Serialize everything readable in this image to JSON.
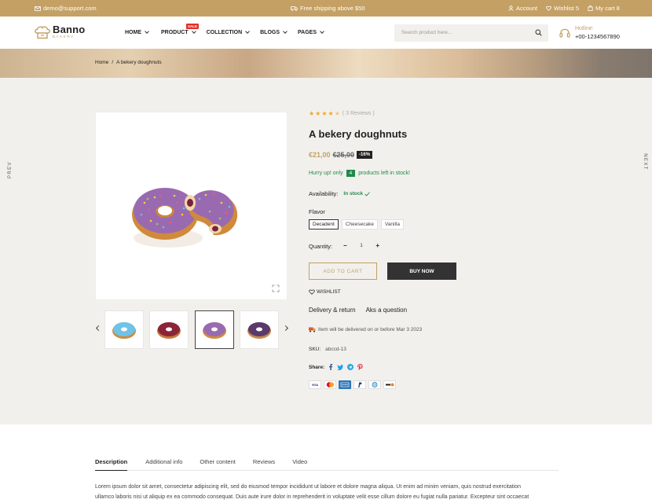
{
  "topbar": {
    "email": "demo@support.com",
    "shipping": "Free shipping above $50",
    "account": "Account",
    "wishlist": "Wishlist 5",
    "cart": "My cart 8"
  },
  "header": {
    "logo_name": "Banno",
    "logo_sub": "BAKERY",
    "nav": [
      {
        "label": "HOME"
      },
      {
        "label": "PRODUCT",
        "badge": "SALE"
      },
      {
        "label": "COLLECTION"
      },
      {
        "label": "BLOGS"
      },
      {
        "label": "PAGES"
      }
    ],
    "search_placeholder": "Search product here...",
    "hotline_label": "Hotline:",
    "hotline_number": "+00-1234567890"
  },
  "breadcrumb": {
    "home": "Home",
    "sep": "/",
    "current": "A bekery doughnuts"
  },
  "side": {
    "prev": "PREV",
    "next": "NEXT"
  },
  "product": {
    "rating": 4.5,
    "reviews": "( 3 Reviews )",
    "title": "A bekery doughnuts",
    "price": "€21,00",
    "old_price": "€25,00",
    "discount": "-16%",
    "stock_prefix": "Hurry up! only",
    "stock_count": "4",
    "stock_suffix": "products left in stock!",
    "availability_label": "Availability:",
    "availability_value": "In stock",
    "flavor_label": "Flavor",
    "flavors": [
      "Decadent",
      "Cheesecake",
      "Vanilla"
    ],
    "selected_flavor": 0,
    "quantity_label": "Quantity:",
    "quantity": "1",
    "add_to_cart": "ADD TO CART",
    "buy_now": "BUY NOW",
    "wishlist": "WISHLIST",
    "delivery_return": "Delivery & return",
    "ask_question": "Aks a question",
    "delivery_note": "Item will be delivered on or before Mar 3 2023",
    "sku_label": "SKU:",
    "sku_value": "abccd-13",
    "share_label": "Share:",
    "payments": [
      "VISA",
      "Mastercard",
      "American Express",
      "PayPal",
      "Diners",
      "Discover"
    ],
    "thumbnails": [
      "blue-doughnut",
      "red-doughnut",
      "purple-doughnut",
      "dark-doughnut"
    ],
    "selected_thumbnail": 2
  },
  "tabs": [
    "Description",
    "Additional info",
    "Other content",
    "Reviews",
    "Video"
  ],
  "description": [
    "Lorem ipsum dolor sit amet, consectetur adipiscing elit, sed do eiusmod tempor incididunt ut labore et dolore magna aliqua. Ut enim ad minim veniam, quis nostrud exercitation",
    "ullamco laboris nisi ut aliquip ex ea commodo consequat. Duis aute irure dolor in reprehenderit in voluptate velit esse cillum dolore eu fugiat nulla pariatur. Excepteur sint occaecat"
  ],
  "colors": {
    "accent": "#c4a064",
    "dark": "#333333",
    "green": "#1f8a4c",
    "sale": "#e0302a"
  }
}
